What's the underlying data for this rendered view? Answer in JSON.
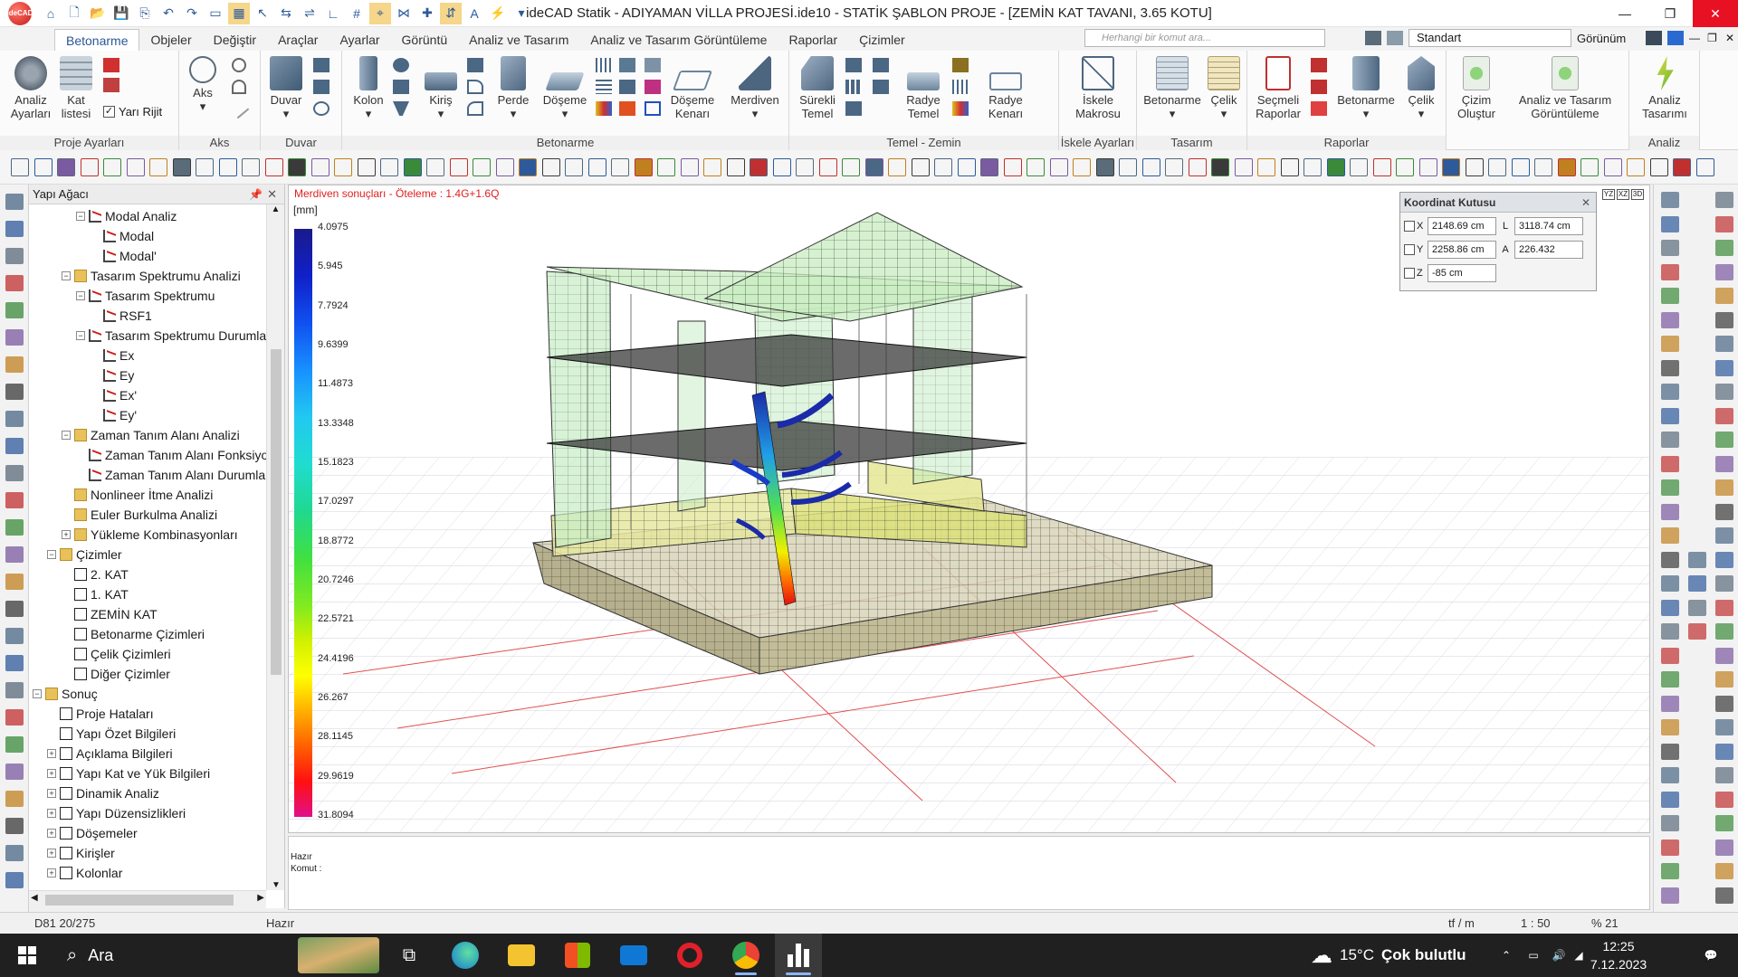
{
  "app": {
    "logo_text": "ideCAD",
    "window_title": "ideCAD Statik - ADIYAMAN VİLLA PROJESİ.ide10 - STATİK ŞABLON PROJE - [ZEMİN KAT TAVANI,  3.65 KOTU]"
  },
  "menu_tabs": [
    "Betonarme",
    "Objeler",
    "Değiştir",
    "Araçlar",
    "Ayarlar",
    "Görüntü",
    "Analiz ve Tasarım",
    "Analiz ve Tasarım Görüntüleme",
    "Raporlar",
    "Çizimler"
  ],
  "command_search": {
    "placeholder": "Herhangi bir komut ara..."
  },
  "style_select": "Standart",
  "view_menu": "Görünüm",
  "ribbon": {
    "groups": {
      "proje": "Proje Ayarları",
      "aks": "Aks",
      "duvar": "Duvar",
      "betonarme": "Betonarme",
      "temel": "Temel - Zemin",
      "iskele": "İskele Ayarları",
      "tasarim": "Tasarım",
      "raporlar": "Raporlar",
      "analiz": "Analiz"
    },
    "buttons": {
      "analiz_ayarlari_1": "Analiz",
      "analiz_ayarlari_2": "Ayarları",
      "kat_listesi_1": "Kat",
      "kat_listesi_2": "listesi",
      "yari_rijit": "Yarı Rijit",
      "aks": "Aks",
      "duvar": "Duvar",
      "kolon": "Kolon",
      "kiris": "Kiriş",
      "perde": "Perde",
      "doseme": "Döşeme",
      "doseme_kenari_1": "Döşeme",
      "doseme_kenari_2": "Kenarı",
      "merdiven": "Merdiven",
      "surekli_temel_1": "Sürekli",
      "surekli_temel_2": "Temel",
      "radye_temel_1": "Radye",
      "radye_temel_2": "Temel",
      "radye_kenari_1": "Radye",
      "radye_kenari_2": "Kenarı",
      "iskele_makrosu_1": "İskele",
      "iskele_makrosu_2": "Makrosu",
      "tasarim_betonarme": "Betonarme",
      "tasarim_celik": "Çelik",
      "secmeli_raporlar_1": "Seçmeli",
      "secmeli_raporlar_2": "Raporlar",
      "rapor_betonarme": "Betonarme",
      "rapor_celik": "Çelik",
      "cizim_olustur_1": "Çizim",
      "cizim_olustur_2": "Oluştur",
      "analiz_gor_1": "Analiz ve Tasarım",
      "analiz_gor_2": "Görüntüleme",
      "analiz_tasarim_1": "Analiz",
      "analiz_tasarim_2": "Tasarımı"
    }
  },
  "tree": {
    "title": "Yapı Ağacı",
    "items": [
      {
        "label": "Modal Analiz",
        "level": 3,
        "icon": "graph",
        "exp": "-"
      },
      {
        "label": "Modal",
        "level": 4,
        "icon": "graph"
      },
      {
        "label": "Modal'",
        "level": 4,
        "icon": "graph"
      },
      {
        "label": "Tasarım Spektrumu Analizi",
        "level": 2,
        "icon": "folder",
        "exp": "-"
      },
      {
        "label": "Tasarım Spektrumu",
        "level": 3,
        "icon": "graph",
        "exp": "-"
      },
      {
        "label": "RSF1",
        "level": 4,
        "icon": "graph"
      },
      {
        "label": "Tasarım Spektrumu Durumları",
        "level": 3,
        "icon": "graph",
        "exp": "-"
      },
      {
        "label": "Ex",
        "level": 4,
        "icon": "graph"
      },
      {
        "label": "Ey",
        "level": 4,
        "icon": "graph"
      },
      {
        "label": "Ex'",
        "level": 4,
        "icon": "graph"
      },
      {
        "label": "Ey'",
        "level": 4,
        "icon": "graph"
      },
      {
        "label": "Zaman Tanım Alanı Analizi",
        "level": 2,
        "icon": "folder",
        "exp": "-"
      },
      {
        "label": "Zaman Tanım Alanı Fonksiyonları",
        "level": 3,
        "icon": "graph"
      },
      {
        "label": "Zaman Tanım Alanı Durumları",
        "level": 3,
        "icon": "graph"
      },
      {
        "label": "Nonlineer İtme Analizi",
        "level": 2,
        "icon": "folder"
      },
      {
        "label": "Euler Burkulma Analizi",
        "level": 2,
        "icon": "folder"
      },
      {
        "label": "Yükleme Kombinasyonları",
        "level": 2,
        "icon": "folder",
        "exp": "+"
      },
      {
        "label": "Çizimler",
        "level": 1,
        "icon": "folder",
        "exp": "-"
      },
      {
        "label": "2. KAT",
        "level": 2,
        "icon": "doc"
      },
      {
        "label": "1. KAT",
        "level": 2,
        "icon": "doc"
      },
      {
        "label": "ZEMİN KAT",
        "level": 2,
        "icon": "doc"
      },
      {
        "label": "Betonarme Çizimleri",
        "level": 2,
        "icon": "doc"
      },
      {
        "label": "Çelik Çizimleri",
        "level": 2,
        "icon": "doc"
      },
      {
        "label": "Diğer Çizimler",
        "level": 2,
        "icon": "doc"
      },
      {
        "label": "Sonuç",
        "level": 0,
        "icon": "folder",
        "exp": "-"
      },
      {
        "label": "Proje Hataları",
        "level": 1,
        "icon": "doc"
      },
      {
        "label": "Yapı Özet Bilgileri",
        "level": 1,
        "icon": "doc"
      },
      {
        "label": "Açıklama Bilgileri",
        "level": 1,
        "icon": "doc",
        "exp": "+"
      },
      {
        "label": "Yapı Kat ve Yük Bilgileri",
        "level": 1,
        "icon": "doc",
        "exp": "+"
      },
      {
        "label": "Dinamik Analiz",
        "level": 1,
        "icon": "doc",
        "exp": "+"
      },
      {
        "label": "Yapı Düzensizlikleri",
        "level": 1,
        "icon": "doc",
        "exp": "+"
      },
      {
        "label": "Döşemeler",
        "level": 1,
        "icon": "doc",
        "exp": "+"
      },
      {
        "label": "Kirişler",
        "level": 1,
        "icon": "doc",
        "exp": "+"
      },
      {
        "label": "Kolonlar",
        "level": 1,
        "icon": "doc",
        "exp": "+"
      }
    ]
  },
  "viewport": {
    "title": "Merdiven sonuçları - Öteleme : 1.4G+1.6Q",
    "unit": "[mm]",
    "legend_values": [
      "4.0975",
      "5.945",
      "7.7924",
      "9.6399",
      "11.4873",
      "13.3348",
      "15.1823",
      "17.0297",
      "18.8772",
      "20.7246",
      "22.5721",
      "24.4196",
      "26.267",
      "28.1145",
      "29.9619",
      "31.8094"
    ]
  },
  "coord_box": {
    "title": "Koordinat Kutusu",
    "x_label": "X",
    "x_value": "2148.69 cm",
    "y_label": "Y",
    "y_value": "2258.86 cm",
    "z_label": "Z",
    "z_value": "-85 cm",
    "l_label": "L",
    "l_value": "3118.74 cm",
    "a_label": "A",
    "a_value": "226.432"
  },
  "messages": {
    "line1": "Hazır",
    "line2": "Komut :"
  },
  "status": {
    "element": "D81 20/275",
    "state": "Hazır",
    "unit": "tf / m",
    "scale": "1 : 50",
    "zoom": "% 21"
  },
  "taskbar": {
    "search": "Ara",
    "temperature": "15°C",
    "weather": "Çok bulutlu",
    "time": "12:25",
    "date": "7.12.2023"
  }
}
